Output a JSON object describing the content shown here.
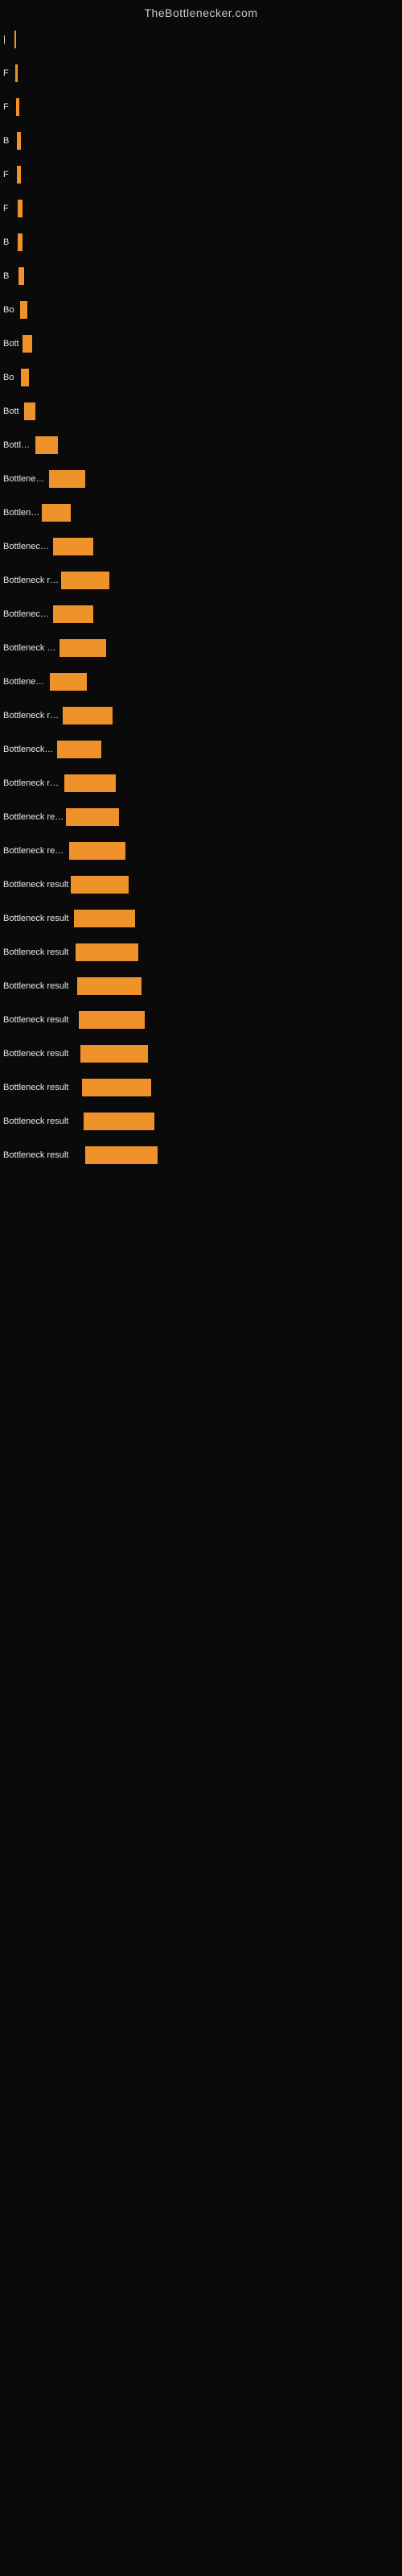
{
  "site": {
    "title": "TheBottlenecker.com"
  },
  "bars": [
    {
      "label": "|",
      "width": 2
    },
    {
      "label": "F",
      "width": 3
    },
    {
      "label": "F",
      "width": 4
    },
    {
      "label": "B",
      "width": 5
    },
    {
      "label": "F",
      "width": 5
    },
    {
      "label": "F",
      "width": 6
    },
    {
      "label": "B",
      "width": 6
    },
    {
      "label": "B",
      "width": 7
    },
    {
      "label": "Bo",
      "width": 9
    },
    {
      "label": "Bott",
      "width": 12
    },
    {
      "label": "Bo",
      "width": 10
    },
    {
      "label": "Bott",
      "width": 14
    },
    {
      "label": "Bottlene",
      "width": 28
    },
    {
      "label": "Bottleneck re",
      "width": 45
    },
    {
      "label": "Bottleneck",
      "width": 36
    },
    {
      "label": "Bottleneck res",
      "width": 50
    },
    {
      "label": "Bottleneck result",
      "width": 60
    },
    {
      "label": "Bottleneck res",
      "width": 50
    },
    {
      "label": "Bottleneck resul",
      "width": 58
    },
    {
      "label": "Bottleneck re",
      "width": 46
    },
    {
      "label": "Bottleneck result",
      "width": 62
    },
    {
      "label": "Bottleneck resu",
      "width": 55
    },
    {
      "label": "Bottleneck result",
      "width": 64
    },
    {
      "label": "Bottleneck result",
      "width": 66
    },
    {
      "label": "Bottleneck result",
      "width": 70
    },
    {
      "label": "Bottleneck result",
      "width": 72
    },
    {
      "label": "Bottleneck result",
      "width": 76
    },
    {
      "label": "Bottleneck result",
      "width": 78
    },
    {
      "label": "Bottleneck result",
      "width": 80
    },
    {
      "label": "Bottleneck result",
      "width": 82
    },
    {
      "label": "Bottleneck result",
      "width": 84
    },
    {
      "label": "Bottleneck result",
      "width": 86
    },
    {
      "label": "Bottleneck result",
      "width": 88
    },
    {
      "label": "Bottleneck result",
      "width": 90
    }
  ]
}
